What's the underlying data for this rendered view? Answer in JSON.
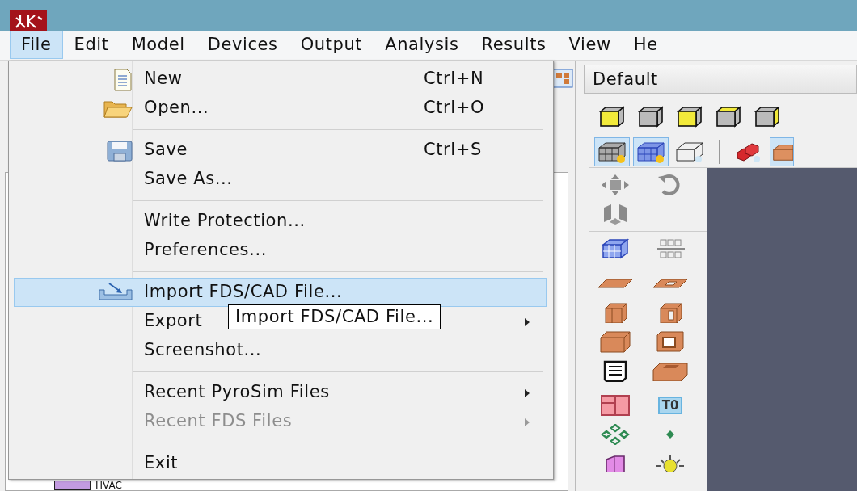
{
  "menu_bar": [
    {
      "label": "File",
      "selected": true
    },
    {
      "label": "Edit",
      "selected": false
    },
    {
      "label": "Model",
      "selected": false
    },
    {
      "label": "Devices",
      "selected": false
    },
    {
      "label": "Output",
      "selected": false
    },
    {
      "label": "Analysis",
      "selected": false
    },
    {
      "label": "Results",
      "selected": false
    },
    {
      "label": "View",
      "selected": false
    },
    {
      "label": "He",
      "selected": false
    }
  ],
  "file_menu": {
    "items": [
      {
        "kind": "item",
        "label": "New",
        "shortcut": "Ctrl+N",
        "highlighted": false,
        "disabled": false,
        "submenu": false
      },
      {
        "kind": "item",
        "label": "Open...",
        "shortcut": "Ctrl+O",
        "highlighted": false,
        "disabled": false,
        "submenu": false
      },
      {
        "kind": "separator"
      },
      {
        "kind": "item",
        "label": "Save",
        "shortcut": "Ctrl+S",
        "highlighted": false,
        "disabled": false,
        "submenu": false
      },
      {
        "kind": "item",
        "label": "Save As...",
        "highlighted": false,
        "disabled": false,
        "submenu": false
      },
      {
        "kind": "separator"
      },
      {
        "kind": "item",
        "label": "Write Protection...",
        "highlighted": false,
        "disabled": false,
        "submenu": false
      },
      {
        "kind": "item",
        "label": "Preferences...",
        "highlighted": false,
        "disabled": false,
        "submenu": false
      },
      {
        "kind": "separator"
      },
      {
        "kind": "item",
        "label": "Import FDS/CAD File...",
        "highlighted": true,
        "disabled": false,
        "submenu": false
      },
      {
        "kind": "item",
        "label": "Export",
        "highlighted": false,
        "disabled": false,
        "submenu": true
      },
      {
        "kind": "item",
        "label": "Screenshot...",
        "highlighted": false,
        "disabled": false,
        "submenu": false
      },
      {
        "kind": "separator"
      },
      {
        "kind": "item",
        "label": "Recent PyroSim Files",
        "highlighted": false,
        "disabled": false,
        "submenu": true
      },
      {
        "kind": "item",
        "label": "Recent FDS Files",
        "highlighted": false,
        "disabled": true,
        "submenu": true
      },
      {
        "kind": "separator"
      },
      {
        "kind": "item",
        "label": "Exit",
        "highlighted": false,
        "disabled": false,
        "submenu": false
      }
    ]
  },
  "tooltip": "Import FDS/CAD File...",
  "view_tab": {
    "label": "Default"
  },
  "view_toolbar": [
    {
      "pressed": true
    },
    {
      "pressed": true
    },
    {
      "pressed": false
    },
    {
      "pressed": false
    },
    {
      "pressed": true
    }
  ],
  "side_toolbar": {
    "badge": "T0"
  },
  "tree": {
    "items": [
      {
        "label": "HVAC",
        "color": "#c39be0"
      }
    ]
  }
}
